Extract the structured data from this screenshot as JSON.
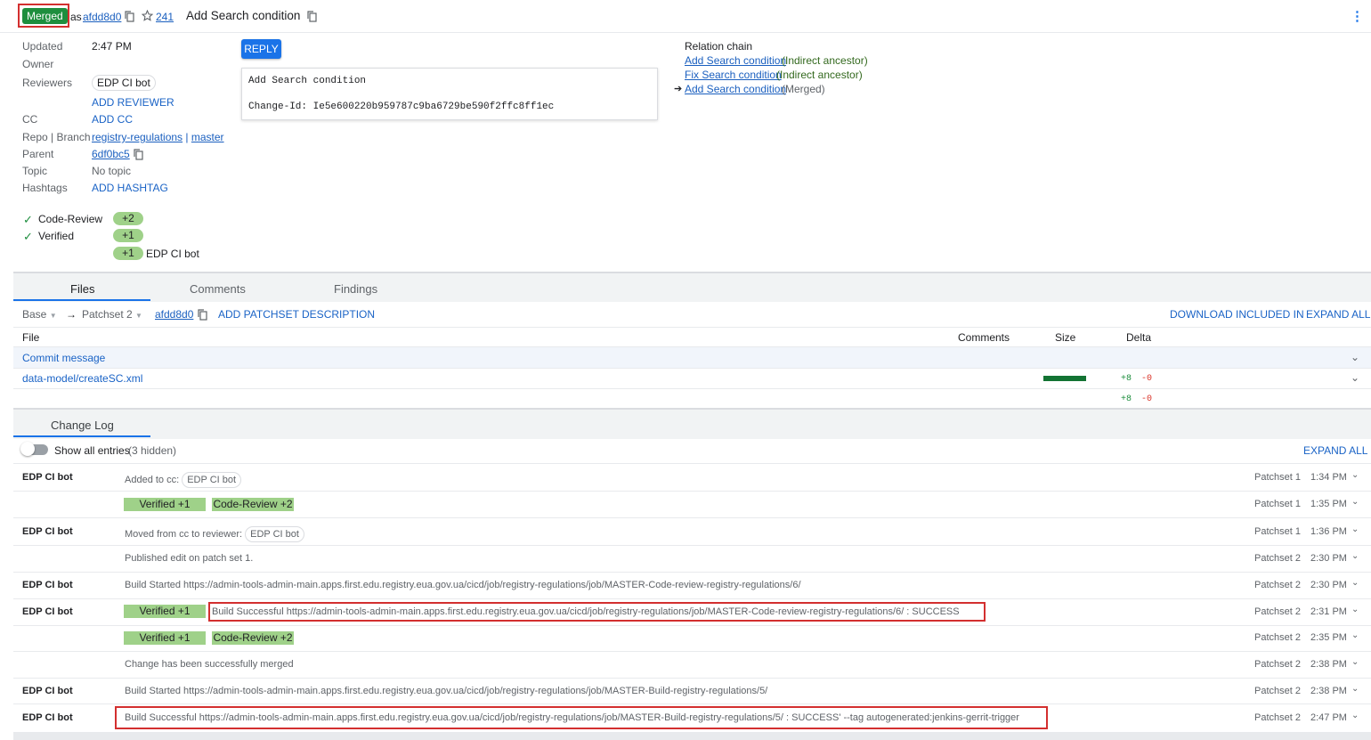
{
  "header": {
    "status": "Merged",
    "as_prefix": "as",
    "commit_hash": "afdd8d0",
    "star_count": "241",
    "title": "Add Search condition"
  },
  "meta": {
    "updated_label": "Updated",
    "updated_value": "2:47 PM",
    "owner_label": "Owner",
    "reviewers_label": "Reviewers",
    "reviewer_chip": "EDP CI bot",
    "add_reviewer": "ADD REVIEWER",
    "cc_label": "CC",
    "add_cc": "ADD CC",
    "repo_label": "Repo | Branch",
    "repo": "registry-regulations",
    "branch_sep": "|",
    "branch": "master",
    "parent_label": "Parent",
    "parent": "6df0bc5",
    "topic_label": "Topic",
    "topic": "No topic",
    "hashtags_label": "Hashtags",
    "add_hashtag": "ADD HASHTAG"
  },
  "labels": [
    {
      "name": "Code-Review",
      "vote": "+2"
    },
    {
      "name": "Verified",
      "vote": "+1"
    },
    {
      "name": "",
      "vote": "+1",
      "who": "EDP CI bot"
    }
  ],
  "reply": "REPLY",
  "commit_message": {
    "line1": "Add Search condition",
    "line2": "Change-Id: Ie5e600220b959787c9ba6729be590f2ffc8ff1ec"
  },
  "relation_chain": {
    "title": "Relation chain",
    "items": [
      {
        "link": "Add Search condition",
        "note": "(Indirect ancestor)"
      },
      {
        "link": "Fix Search condition",
        "note": "(Indirect ancestor)"
      },
      {
        "link": "Add Search condition",
        "note": "(Merged)",
        "arrow": "➔"
      }
    ]
  },
  "tabs": [
    "Files",
    "Comments",
    "Findings"
  ],
  "files_toolbar": {
    "base": "Base",
    "arrow": "→",
    "patchset": "Patchset 2",
    "hash": "afdd8d0",
    "add_desc": "ADD PATCHSET DESCRIPTION",
    "download": "DOWNLOAD",
    "included_in": "INCLUDED IN",
    "expand_all": "EXPAND ALL"
  },
  "files_table": {
    "headers": {
      "file": "File",
      "comments": "Comments",
      "size": "Size",
      "delta": "Delta"
    },
    "rows": [
      {
        "name": "Commit message"
      },
      {
        "name": "data-model/createSC.xml",
        "plus": "+8",
        "minus": "-0"
      }
    ],
    "total": {
      "plus": "+8",
      "minus": "-0"
    }
  },
  "changelog": {
    "title": "Change Log",
    "toggle_label": "Show all entries",
    "hidden_count": "(3 hidden)",
    "expand_all": "EXPAND ALL",
    "entries": [
      {
        "name": "EDP CI bot",
        "msg": "Added to cc:",
        "chip": "EDP CI bot",
        "ps": "Patchset 1",
        "time": "1:34 PM"
      },
      {
        "name": "",
        "votes": [
          "Verified +1",
          "Code-Review +2"
        ],
        "ps": "Patchset 1",
        "time": "1:35 PM"
      },
      {
        "name": "EDP CI bot",
        "msg": "Moved from cc to reviewer:",
        "chip": "EDP CI bot",
        "ps": "Patchset 1",
        "time": "1:36 PM"
      },
      {
        "name": "",
        "msg": "Published edit on patch set 1.",
        "ps": "Patchset 2",
        "time": "2:30 PM"
      },
      {
        "name": "EDP CI bot",
        "msg": "Build Started https://admin-tools-admin-main.apps.first.edu.registry.eua.gov.ua/cicd/job/registry-regulations/job/MASTER-Code-review-registry-regulations/6/",
        "ps": "Patchset 2",
        "time": "2:30 PM"
      },
      {
        "name": "EDP CI bot",
        "votes": [
          "Verified +1"
        ],
        "msg": "Build Successful https://admin-tools-admin-main.apps.first.edu.registry.eua.gov.ua/cicd/job/registry-regulations/job/MASTER-Code-review-registry-regulations/6/ : SUCCESS",
        "ps": "Patchset 2",
        "time": "2:31 PM"
      },
      {
        "name": "",
        "votes": [
          "Verified +1",
          "Code-Review +2"
        ],
        "ps": "Patchset 2",
        "time": "2:35 PM"
      },
      {
        "name": "",
        "msg": "Change has been successfully merged",
        "ps": "Patchset 2",
        "time": "2:38 PM"
      },
      {
        "name": "EDP CI bot",
        "msg": "Build Started https://admin-tools-admin-main.apps.first.edu.registry.eua.gov.ua/cicd/job/registry-regulations/job/MASTER-Build-registry-regulations/5/",
        "ps": "Patchset 2",
        "time": "2:38 PM"
      },
      {
        "name": "EDP CI bot",
        "msg": "Build Successful https://admin-tools-admin-main.apps.first.edu.registry.eua.gov.ua/cicd/job/registry-regulations/job/MASTER-Build-registry-regulations/5/ : SUCCESS' --tag autogenerated:jenkins-gerrit-trigger",
        "ps": "Patchset 2",
        "time": "2:47 PM"
      }
    ]
  },
  "colors": {
    "merged": "#1e8e3e",
    "vote": "#9fd189",
    "link": "#1a63c6",
    "highlight": "#d32f2f"
  }
}
